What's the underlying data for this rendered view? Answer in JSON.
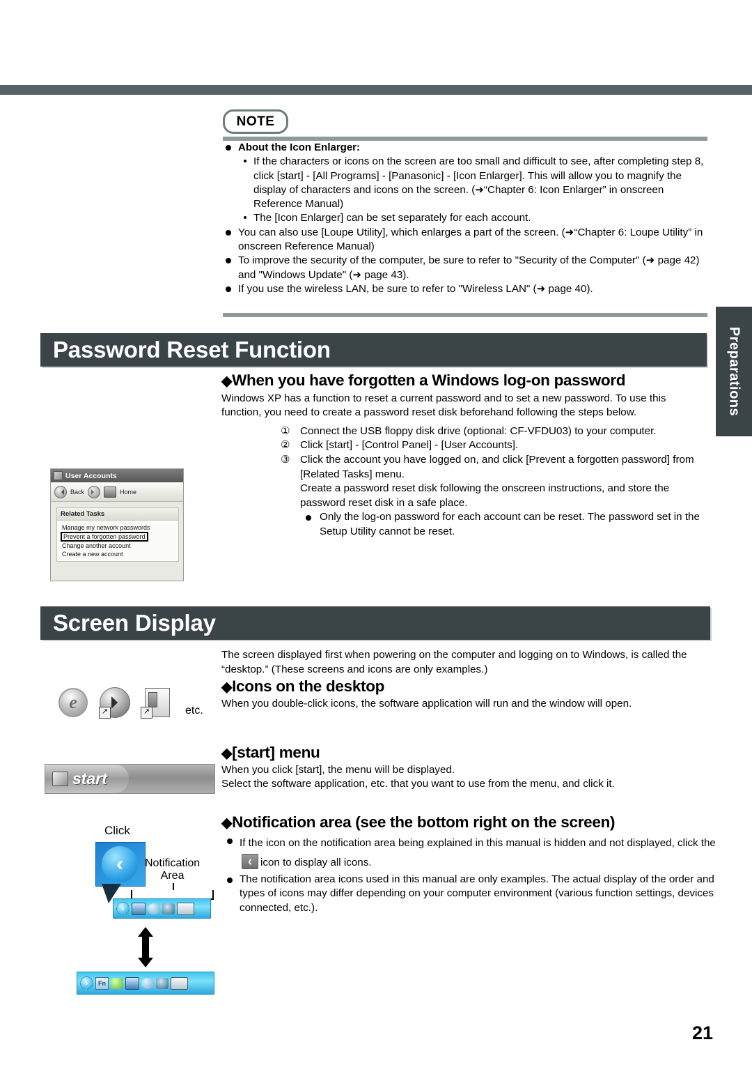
{
  "page": {
    "number": "21",
    "thumb_tab": "Preparations"
  },
  "note": {
    "badge": "NOTE",
    "heading": "About the Icon Enlarger:",
    "sub_bullets": [
      "If the characters or icons on the screen are too small and difficult to see, after completing step 8, click [start] - [All Programs] - [Panasonic] - [Icon Enlarger]. This will allow you to magnify the display of characters and icons on the screen. (➜“Chapter 6: Icon Enlarger” in onscreen Reference Manual)",
      "The [Icon Enlarger] can be set separately for each account."
    ],
    "bullets": [
      "You can also use [Loupe Utility], which enlarges a part of the screen. (➜“Chapter 6: Loupe Utility” in onscreen Reference Manual)",
      "To improve the security of the computer, be sure to refer to \"Security of the Computer\" (➜ page 42) and \"Windows Update\" (➜ page 43).",
      "If you use the wireless LAN, be sure to refer to \"Wireless LAN\" (➜ page 40)."
    ]
  },
  "password_section": {
    "title": "Password Reset Function",
    "subheading": "When you have forgotten a Windows log-on password",
    "intro": "Windows XP has a function to reset a current password and to set a new password. To use this function, you need to create a password reset disk beforehand following the steps below.",
    "steps": [
      {
        "marker": "①",
        "text": "Connect the USB floppy disk drive (optional: CF-VFDU03) to your computer."
      },
      {
        "marker": "②",
        "text": "Click [start] - [Control Panel] - [User Accounts]."
      },
      {
        "marker": "③",
        "text": "Click the account you have logged on, and click [Prevent a forgotten password] from [Related Tasks] menu."
      }
    ],
    "step3_extra": "Create a password reset disk following the onscreen instructions, and store the password reset disk in a safe place.",
    "note_bullet": "Only the log-on password for each account can be reset. The password set in the Setup Utility cannot be reset."
  },
  "user_accounts_figure": {
    "window_title": "User Accounts",
    "toolbar": [
      {
        "label": "Back",
        "icon": "back-arrow-icon"
      },
      {
        "label": "",
        "icon": "forward-arrow-icon"
      },
      {
        "label": "Home",
        "icon": "home-icon"
      }
    ],
    "panel_title": "Related Tasks",
    "links": [
      "Manage my network passwords",
      "Prevent a forgotten password",
      "Change another account",
      "Create a new account"
    ],
    "highlighted_link": "Prevent a forgotten password"
  },
  "screen_section": {
    "title": "Screen Display",
    "intro": "The screen displayed first when powering on the computer and logging on to Windows, is called the “desktop.” (These screens and icons are only examples.)",
    "icons_heading": "Icons on the desktop",
    "icons_body": "When you double-click icons, the software application will run and the window will open.",
    "start_heading": "[start] menu",
    "start_body_1": "When you click [start], the menu will be displayed.",
    "start_body_2": "Select the software application, etc. that you want to use from the menu, and click it.",
    "notify_heading": "Notification area (see the bottom right on the screen)",
    "notify_bullet_1a": "If the icon on the notification area being explained in this manual is hidden and not displayed, click the",
    "notify_bullet_1b": "icon to display all icons.",
    "notify_bullet_2": "The notification area icons used in this manual are only examples.  The actual display of the order and types of icons may differ depending on your computer environment (various function settings, devices connected, etc.)."
  },
  "desktop_icons_figure": {
    "icons": [
      "internet-explorer-icon",
      "media-player-icon",
      "document-shortcut-icon"
    ],
    "etc_label": "etc."
  },
  "start_button_figure": {
    "label": "start"
  },
  "notification_figure": {
    "click_label": "Click",
    "area_label_line1": "Notification",
    "area_label_line2": "Area",
    "collapsed_icons": [
      "chevron-left-icon",
      "network-icon",
      "speaker-icon",
      "power-icon",
      "display-icon"
    ],
    "expanded_icons": [
      "chevron-right-icon",
      "fn-key-icon",
      "green-icon",
      "network-icon",
      "speaker-icon",
      "power-icon",
      "display-icon"
    ]
  },
  "colors": {
    "rule": "#566366",
    "section_bar": "#3b4547",
    "note_rule": "#8e9b9d"
  }
}
